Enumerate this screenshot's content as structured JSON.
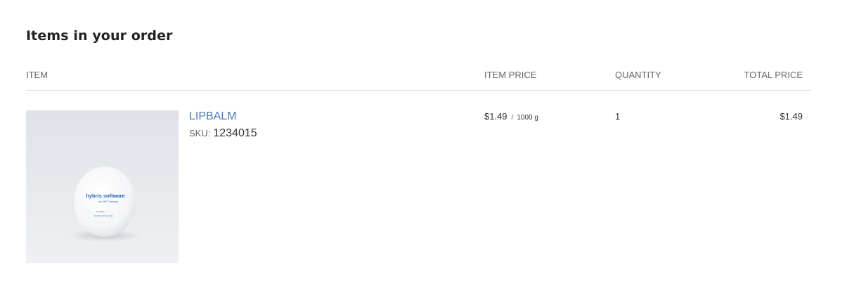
{
  "section": {
    "title": "Items in your order"
  },
  "table": {
    "headers": {
      "item": "ITEM",
      "item_price": "ITEM PRICE",
      "quantity": "QUANTITY",
      "total_price": "TOTAL PRICE"
    },
    "rows": [
      {
        "name": "LIPBALM",
        "sku_label": "SKU:",
        "sku": "1234015",
        "price": "$1.49",
        "price_separator": "/",
        "unit": "1000 g",
        "quantity": "1",
        "total": "$1.49",
        "image_text": {
          "brand": "hybris software",
          "tagline": "An SAP Company",
          "product": "Lip Balm",
          "detail": "Net Wt. 0.15 oz (7g)"
        }
      }
    ]
  },
  "colors": {
    "link": "#4a7ab3",
    "divider": "#dddddd",
    "header_text": "#666666",
    "logo_blue": "#1f5fbf"
  }
}
